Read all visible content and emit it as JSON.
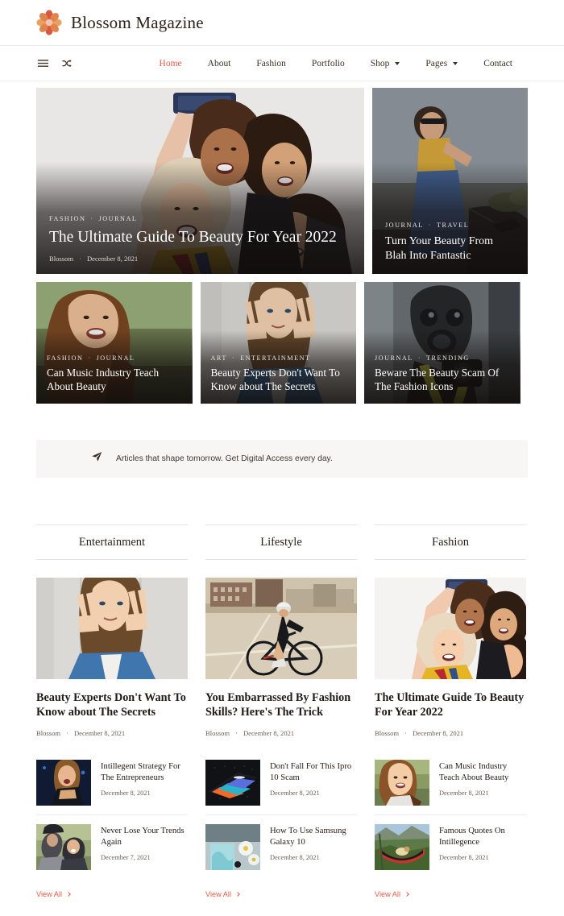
{
  "site": {
    "brand": "Blossom Magazine",
    "logo_icon": "flower-icon"
  },
  "nav": {
    "hamburger_icon": "hamburger-menu-icon",
    "shuffle_icon": "shuffle-random-icon",
    "items": [
      {
        "label": "Home",
        "active": true,
        "dropdown": false
      },
      {
        "label": "About",
        "active": false,
        "dropdown": false
      },
      {
        "label": "Fashion",
        "active": false,
        "dropdown": false
      },
      {
        "label": "Portfolio",
        "active": false,
        "dropdown": false
      },
      {
        "label": "Shop",
        "active": false,
        "dropdown": true
      },
      {
        "label": "Pages",
        "active": false,
        "dropdown": true
      },
      {
        "label": "Contact",
        "active": false,
        "dropdown": false
      }
    ]
  },
  "hero": {
    "main": {
      "categories": [
        "FASHION",
        "JOURNAL"
      ],
      "title": "The Ultimate Guide To Beauty For Year 2022",
      "author": "Blossom",
      "date": "December 8, 2021",
      "image_alt": "four-women-taking-selfie"
    },
    "side": {
      "categories": [
        "JOURNAL",
        "TRAVEL"
      ],
      "title": "Turn Your Beauty From Blah Into Fantastic",
      "image_alt": "woman-sitting-on-car-hood"
    },
    "row2": [
      {
        "categories": [
          "FASHION",
          "JOURNAL"
        ],
        "title": "Can Music Industry Teach About Beauty",
        "image_alt": "smiling-woman-outdoors"
      },
      {
        "categories": [
          "ART",
          "ENTERTAINMENT"
        ],
        "title": "Beauty Experts Don't Want To Know about The Secrets",
        "image_alt": "woman-making-peace-signs"
      },
      {
        "categories": [
          "JOURNAL",
          "TRENDING"
        ],
        "title": "Beware The Beauty Scam Of The Fashion Icons",
        "image_alt": "person-in-gas-mask-with-camera"
      }
    ]
  },
  "ticker": {
    "icon": "paper-plane-icon",
    "text": "Articles that shape tomorrow. Get Digital Access every day."
  },
  "columns": [
    {
      "heading": "Entertainment",
      "featured": {
        "title": "Beauty Experts Don't Want To Know about The Secrets",
        "author": "Blossom",
        "date": "December 8, 2021",
        "image_alt": "woman-making-peace-signs"
      },
      "items": [
        {
          "title": "Intillegent Strategy For The Entrepreneurs",
          "date": "December 8, 2021",
          "image_alt": "singer-on-stage"
        },
        {
          "title": "Never Lose Your Trends Again",
          "date": "December 7, 2021",
          "image_alt": "couple-piggyback-outdoors"
        }
      ],
      "view_all": "View All"
    },
    {
      "heading": "Lifestyle",
      "featured": {
        "title": "You Embarrassed By Fashion Skills? Here's The Trick",
        "author": "Blossom",
        "date": "December 8, 2021",
        "image_alt": "cyclist-on-road-bike"
      },
      "items": [
        {
          "title": "Don't Fall For This Ipro 10 Scam",
          "date": "December 8, 2021",
          "image_alt": "smartphone-with-gradient-screen"
        },
        {
          "title": "How To Use Samsung Galaxy 10",
          "date": "December 8, 2021",
          "image_alt": "tablet-with-flowers"
        }
      ],
      "view_all": "View All"
    },
    {
      "heading": "Fashion",
      "featured": {
        "title": "The Ultimate Guide To Beauty For Year 2022",
        "author": "Blossom",
        "date": "December 8, 2021",
        "image_alt": "four-women-taking-selfie"
      },
      "items": [
        {
          "title": "Can Music Industry Teach About Beauty",
          "date": "December 8, 2021",
          "image_alt": "smiling-woman-outdoors"
        },
        {
          "title": "Famous Quotes On Intillegence",
          "date": "December 8, 2021",
          "image_alt": "person-in-hammock-mountains"
        }
      ],
      "view_all": "View All"
    }
  ],
  "colors": {
    "accent": "#e05d44",
    "text": "#211a15",
    "muted": "#6a5d54",
    "ticker_bg": "#f7f6f5"
  }
}
